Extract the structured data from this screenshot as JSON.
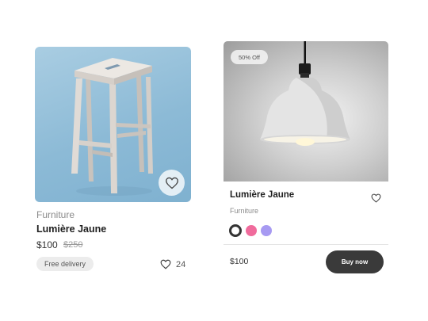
{
  "cards": [
    {
      "category": "Furniture",
      "title": "Lumière Jaune",
      "price": "$100",
      "old_price": "$250",
      "badge": "Free delivery",
      "likes": "24",
      "image_bg": "#8cbad6"
    },
    {
      "discount_label": "50% Off",
      "title": "Lumière Jaune",
      "category": "Furniture",
      "price": "$100",
      "buy_label": "Buy now",
      "swatches": [
        {
          "color": "#ffffff",
          "selected": true
        },
        {
          "color": "#f06b9c",
          "selected": false
        },
        {
          "color": "#a79af2",
          "selected": false
        }
      ]
    }
  ],
  "icons": {
    "favorite": "heart-icon"
  },
  "colors": {
    "button_dark": "#3a3a3a",
    "badge_bg": "#ececec"
  }
}
